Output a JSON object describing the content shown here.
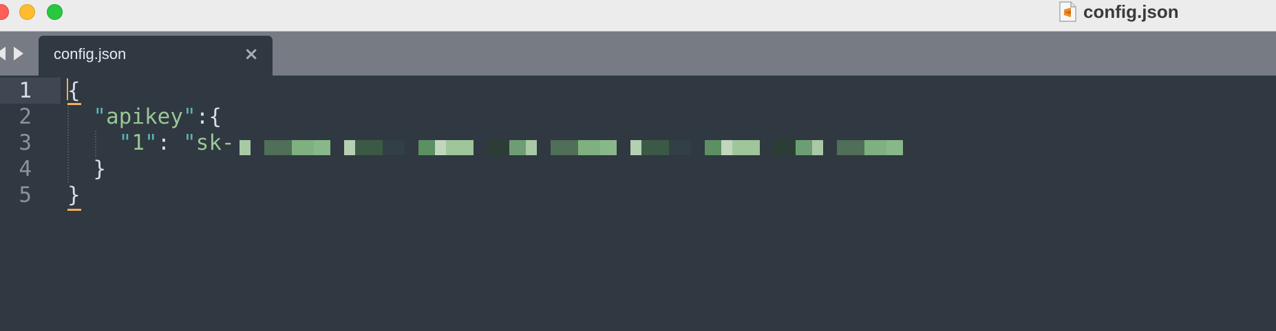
{
  "window": {
    "title": "config.json",
    "file_icon": "sublime-text-file-icon",
    "traffic_lights": {
      "close": "#fe5f57",
      "minimize": "#febc2e",
      "zoom": "#28c840"
    }
  },
  "tabs": [
    {
      "label": "config.json",
      "active": true,
      "close_glyph": "×"
    }
  ],
  "editor": {
    "theme": {
      "background": "#303841",
      "punctuation": "#d8dee9",
      "string_quote": "#5fb4b4",
      "string": "#99c794",
      "accent": "#f9ae58"
    },
    "active_line": 1,
    "lines": [
      {
        "number": "1",
        "tokens": [
          {
            "t": "{",
            "c": "p"
          }
        ]
      },
      {
        "number": "2",
        "tokens": [
          {
            "t": "  ",
            "c": "p"
          },
          {
            "t": "\"",
            "c": "q"
          },
          {
            "t": "apikey",
            "c": "k"
          },
          {
            "t": "\"",
            "c": "q"
          },
          {
            "t": ":{",
            "c": "p"
          }
        ]
      },
      {
        "number": "3",
        "tokens": [
          {
            "t": "    ",
            "c": "p"
          },
          {
            "t": "\"",
            "c": "q"
          },
          {
            "t": "1",
            "c": "k"
          },
          {
            "t": "\"",
            "c": "q"
          },
          {
            "t": ": ",
            "c": "p"
          },
          {
            "t": "\"",
            "c": "q"
          },
          {
            "t": "sk-",
            "c": "k"
          }
        ]
      },
      {
        "number": "4",
        "tokens": [
          {
            "t": "  }",
            "c": "p"
          }
        ]
      },
      {
        "number": "5",
        "tokens": [
          {
            "t": "}",
            "c": "p"
          }
        ]
      }
    ],
    "redacted_value": "pixelated-api-key"
  }
}
